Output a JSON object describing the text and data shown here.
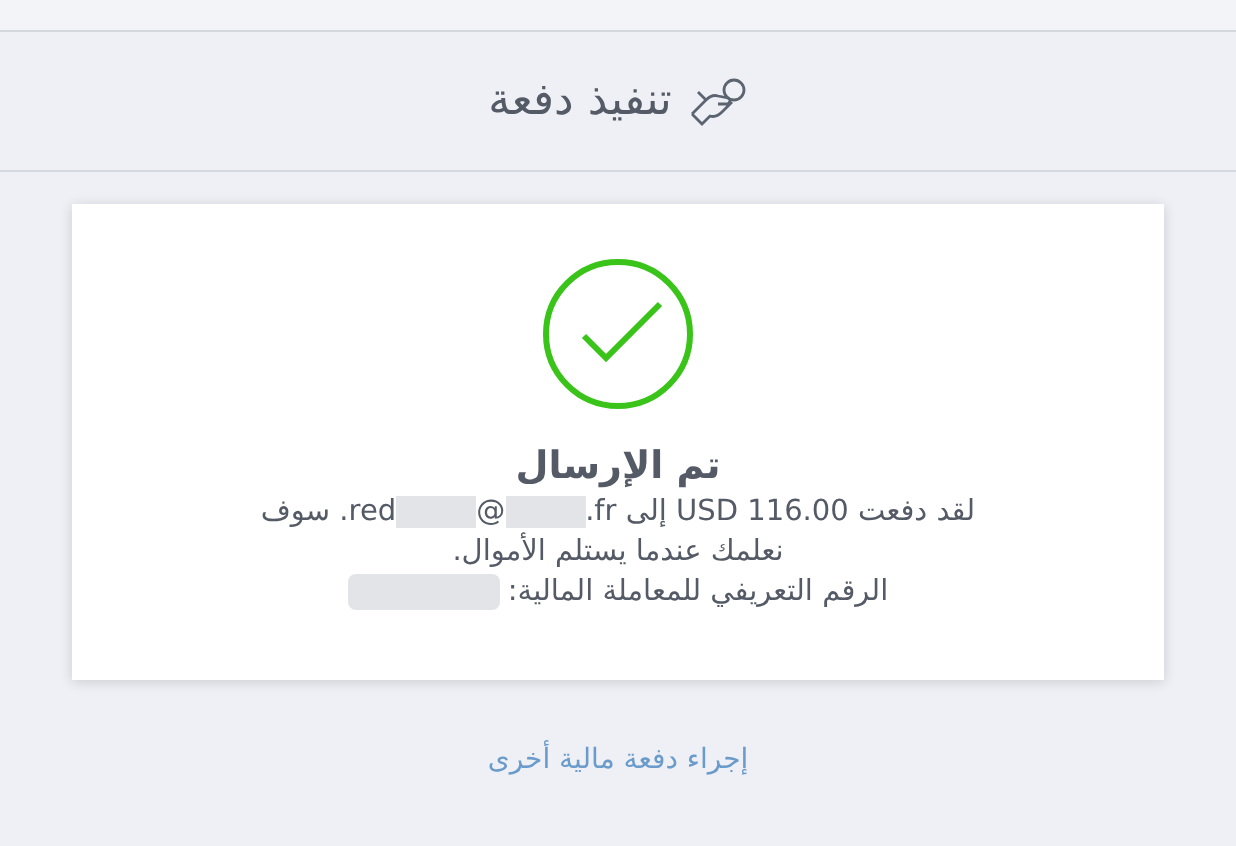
{
  "header": {
    "title": "تنفيذ دفعة"
  },
  "card": {
    "status_title": "تم الإرسال",
    "message_before": "لقد دفعت USD 116.00 إلى ",
    "email_start": "red",
    "email_at": "@",
    "email_end": ".fr",
    "message_after": ". سوف نعلمك عندما يستلم الأموال.",
    "transaction_label": "الرقم التعريفي للمعاملة المالية:"
  },
  "link": "إجراء دفعة مالية أخرى"
}
